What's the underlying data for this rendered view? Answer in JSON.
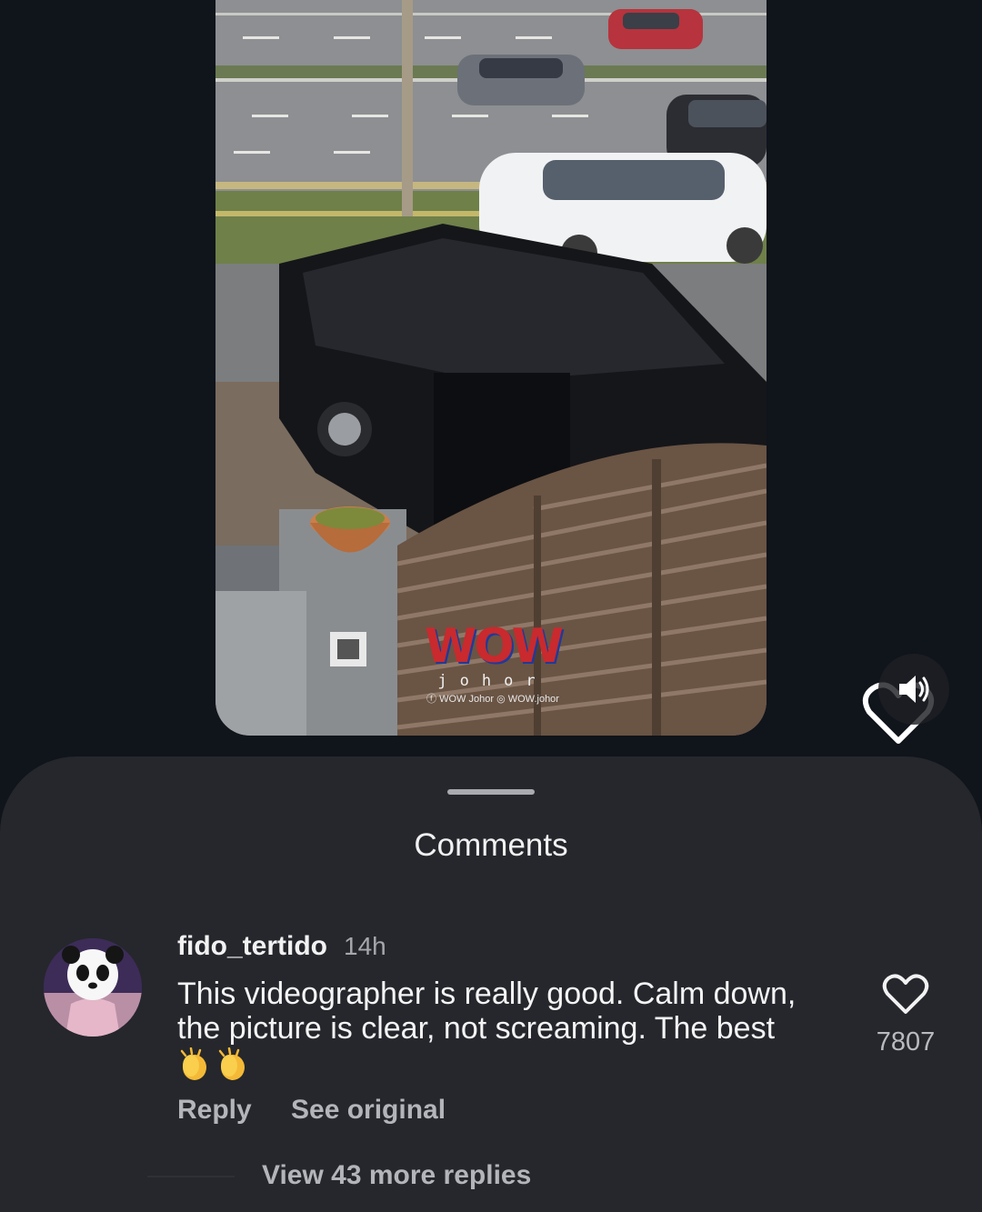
{
  "video": {
    "watermark": {
      "logo_text": "WOW",
      "sub_text": "johor",
      "handle_facebook": "WOW Johor",
      "handle_instagram": "WOW.johor"
    }
  },
  "controls": {
    "like_icon": "heart-outline-icon",
    "mute_icon": "speaker-icon"
  },
  "comments_sheet": {
    "title": "Comments",
    "comment": {
      "username": "fido_tertido",
      "time": "14h",
      "text": "This videographer is really good. Calm down, the picture is clear, not screaming. The best",
      "emoji": [
        "👏",
        "👏"
      ],
      "like_count": "7807",
      "reply_label": "Reply",
      "see_original_label": "See original",
      "view_replies_label": "View 43 more replies"
    }
  },
  "colors": {
    "background": "#10141b",
    "sheet": "#25272c",
    "text_primary": "#f4f4f5",
    "text_secondary": "#b3b5ba"
  }
}
